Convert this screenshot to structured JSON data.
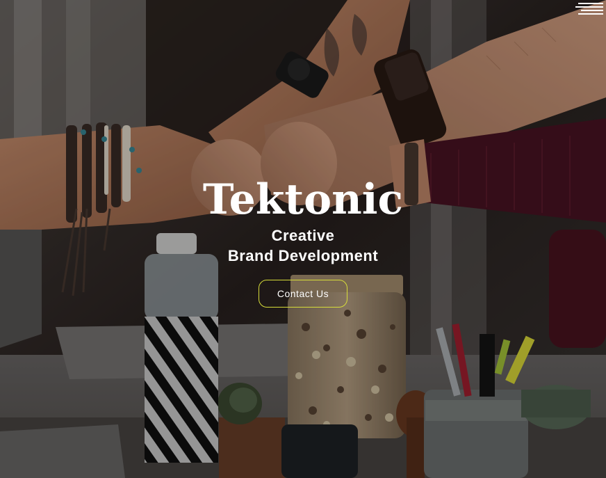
{
  "hero": {
    "title": "Tektonic",
    "tagline_line1": "Creative",
    "tagline_line2": "Brand Development",
    "cta_label": "Contact Us"
  },
  "nav": {
    "menu_icon": "hamburger-menu-icon"
  },
  "colors": {
    "title_text": "#ffffff",
    "cta_border": "#d7dd3a",
    "overlay": "rgba(0,0,0,0.18)"
  }
}
